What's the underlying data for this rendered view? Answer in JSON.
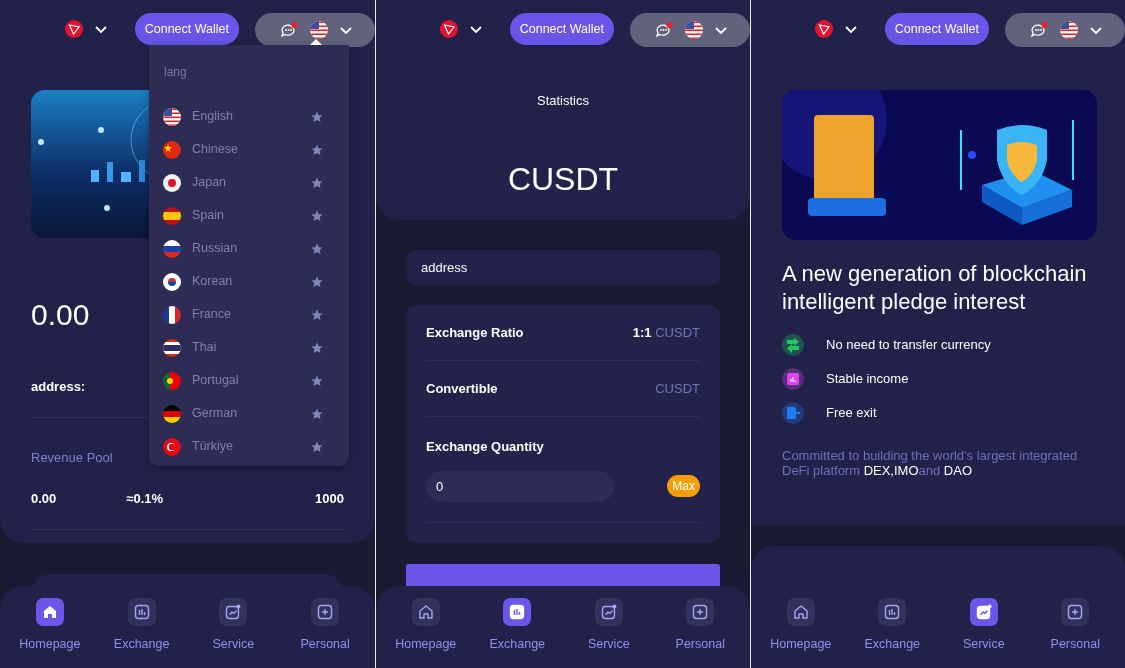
{
  "screens": [
    {
      "kind": "home",
      "header": {
        "button": "Connect Wallet"
      },
      "hero": {
        "kind": "picture"
      },
      "balance": "0.00",
      "address_label": "address:",
      "stats": {
        "labels": [
          "Revenue Pool"
        ],
        "values": [
          "0.00",
          "≈0.1%",
          "1000"
        ]
      },
      "language_menu": {
        "title": "lang",
        "items": [
          {
            "label": "English",
            "kind": "us"
          },
          {
            "label": "Chinese",
            "kind": "cn"
          },
          {
            "label": "Japan",
            "kind": "jp"
          },
          {
            "label": "Spain",
            "kind": "es"
          },
          {
            "label": "Russian",
            "kind": "ru"
          },
          {
            "label": "Korean",
            "kind": "kr"
          },
          {
            "label": "France",
            "kind": "fr"
          },
          {
            "label": "Thai",
            "kind": "th"
          },
          {
            "label": "Portugal",
            "kind": "pt"
          },
          {
            "label": "German",
            "kind": "de"
          },
          {
            "label": "Türkiye",
            "kind": "tr"
          }
        ]
      },
      "nav": [
        {
          "label": "Homepage",
          "kind": "home",
          "selected": true
        },
        {
          "label": "Exchange",
          "kind": "exchange",
          "selected": false
        },
        {
          "label": "Service",
          "kind": "service",
          "selected": false
        },
        {
          "label": "Personal",
          "kind": "personal",
          "selected": false
        }
      ]
    },
    {
      "kind": "exchange",
      "header": {
        "button": "Connect Wallet"
      },
      "title": "Statistics",
      "token": "CUSDT",
      "address": {
        "placeholder": "address"
      },
      "rows": [
        {
          "label": "Exchange Ratio",
          "value": "1:1",
          "unit": "CUSDT"
        },
        {
          "label": "Convertible",
          "unit": "CUSDT"
        }
      ],
      "quantity": {
        "label": "Exchange Quantity",
        "value": "0",
        "max": "Max"
      },
      "nav": [
        {
          "label": "Homepage",
          "kind": "home",
          "selected": false
        },
        {
          "label": "Exchange",
          "kind": "exchange",
          "selected": true
        },
        {
          "label": "Service",
          "kind": "service",
          "selected": false
        },
        {
          "label": "Personal",
          "kind": "personal",
          "selected": false
        }
      ]
    },
    {
      "kind": "service",
      "header": {
        "button": "Connect Wallet"
      },
      "banner": {
        "kind": "picture"
      },
      "headline": "A new generation of blockchain intelligent pledge interest",
      "features": [
        {
          "label": "No need to transfer currency",
          "kind": "transfer",
          "color": "#22c55e"
        },
        {
          "label": "Stable income",
          "kind": "income",
          "color": "#d946ef"
        },
        {
          "label": "Free exit",
          "kind": "exit",
          "color": "#1d7cf2"
        }
      ],
      "description": "Committed to building the world's largest integrated DeFi platform **DEX,IMO**and **DAO**",
      "nav": [
        {
          "label": "Homepage",
          "kind": "home",
          "selected": false
        },
        {
          "label": "Exchange",
          "kind": "exchange",
          "selected": false
        },
        {
          "label": "Service",
          "kind": "service",
          "selected": true
        },
        {
          "label": "Personal",
          "kind": "personal",
          "selected": false
        }
      ]
    }
  ]
}
